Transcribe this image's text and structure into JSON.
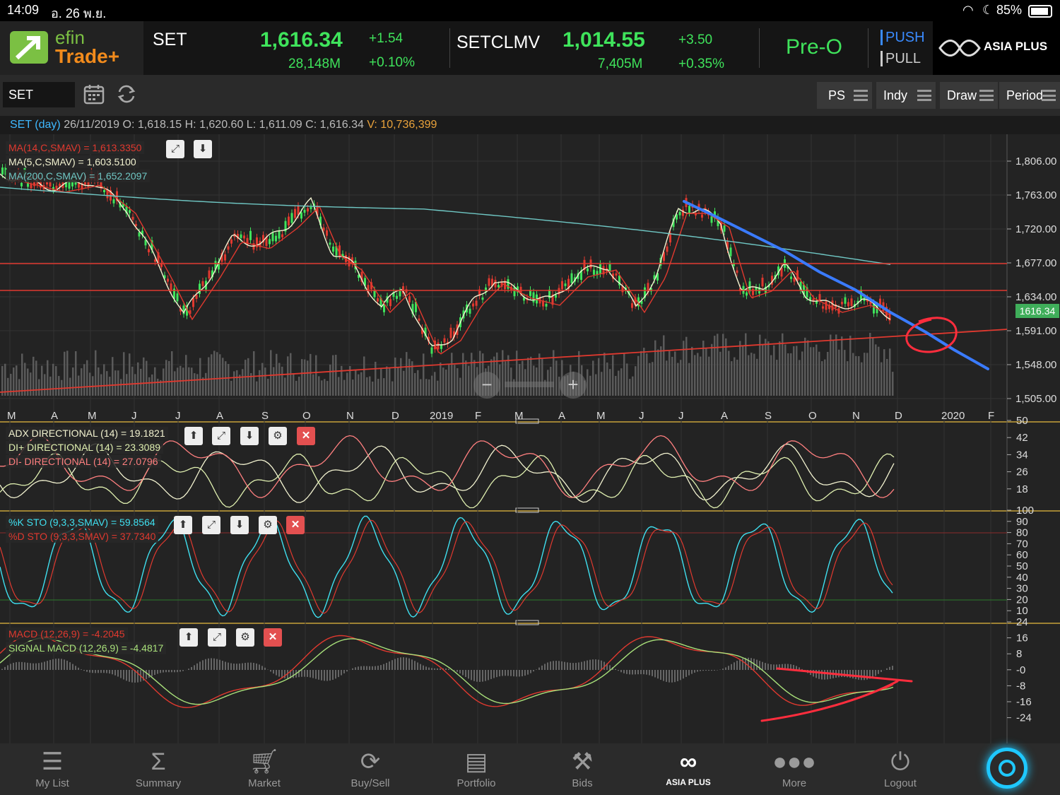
{
  "status": {
    "time": "14:09",
    "date": "อ. 26 พ.ย.",
    "battery": "85%"
  },
  "logo": {
    "line1": "efin",
    "line2": "Trade+"
  },
  "quotes": [
    {
      "symbol": "SET",
      "last": "1,616.34",
      "volume": "28,148M",
      "change": "+1.54",
      "pct": "+0.10%"
    },
    {
      "symbol": "SETCLMV",
      "last": "1,014.55",
      "volume": "7,405M",
      "change": "+3.50",
      "pct": "+0.35%"
    }
  ],
  "market_state": "Pre-O",
  "push_label": "PUSH",
  "pull_label": "PULL",
  "brand": "ASIA PLUS",
  "toolbar": {
    "symbol_value": "SET",
    "buttons": [
      "PS",
      "Indy",
      "Draw",
      "Period"
    ]
  },
  "info": {
    "name": "SET (day)",
    "date": "26/11/2019",
    "o_label": "O:",
    "o": "1,618.15",
    "h_label": "H:",
    "h": "1,620.60",
    "l_label": "L:",
    "l": "1,611.09",
    "c_label": "C:",
    "c": "1,616.34",
    "v_label": "V:",
    "v": "10,736,399"
  },
  "legends": {
    "ma14": "MA(14,C,SMAV) = 1,613.3350",
    "ma5": "MA(5,C,SMAV) = 1,603.5100",
    "ma200": "MA(200,C,SMAV) = 1,652.2097",
    "adx": "ADX DIRECTIONAL (14) = 19.1821",
    "dip": "DI+ DIRECTIONAL (14) = 23.3089",
    "dim": "DI- DIRECTIONAL (14) = 27.0796",
    "k": "%K STO (9,3,3,SMAV) = 59.8564",
    "d": "%D STO (9,3,3,SMAV) = 37.7340",
    "macd": "MACD (12,26,9) = -4.2045",
    "signal": "SIGNAL MACD (12,26,9) = -4.4817"
  },
  "price_axis": [
    "1,806.00",
    "1,763.00",
    "1,720.00",
    "1,677.00",
    "1,634.00",
    "1,591.00",
    "1,548.00",
    "1,505.00"
  ],
  "price_tag": "1616.34",
  "month_labels": [
    "M",
    "A",
    "M",
    "J",
    "J",
    "A",
    "S",
    "O",
    "N",
    "D",
    "2019",
    "F",
    "M",
    "A",
    "M",
    "J",
    "J",
    "A",
    "S",
    "O",
    "N",
    "D",
    "2020",
    "F"
  ],
  "adx_axis": [
    "50",
    "42",
    "34",
    "26",
    "18"
  ],
  "sto_axis": [
    "100",
    "90",
    "80",
    "70",
    "60",
    "50",
    "40",
    "30",
    "20",
    "10"
  ],
  "macd_axis": [
    "24",
    "16",
    "8",
    "-0",
    "-8",
    "-16",
    "-24"
  ],
  "nav": [
    "My List",
    "Summary",
    "Market",
    "Buy/Sell",
    "Portfolio",
    "Bids",
    "ASIA PLUS",
    "More",
    "Logout"
  ],
  "colors": {
    "up": "#3fe35b",
    "down": "#e0392f",
    "ma14": "#e0392f",
    "ma5": "#f2f2d0",
    "ma200": "#6fc7c4",
    "trend": "#3a7bff",
    "annot": "#ff2d3d"
  }
}
